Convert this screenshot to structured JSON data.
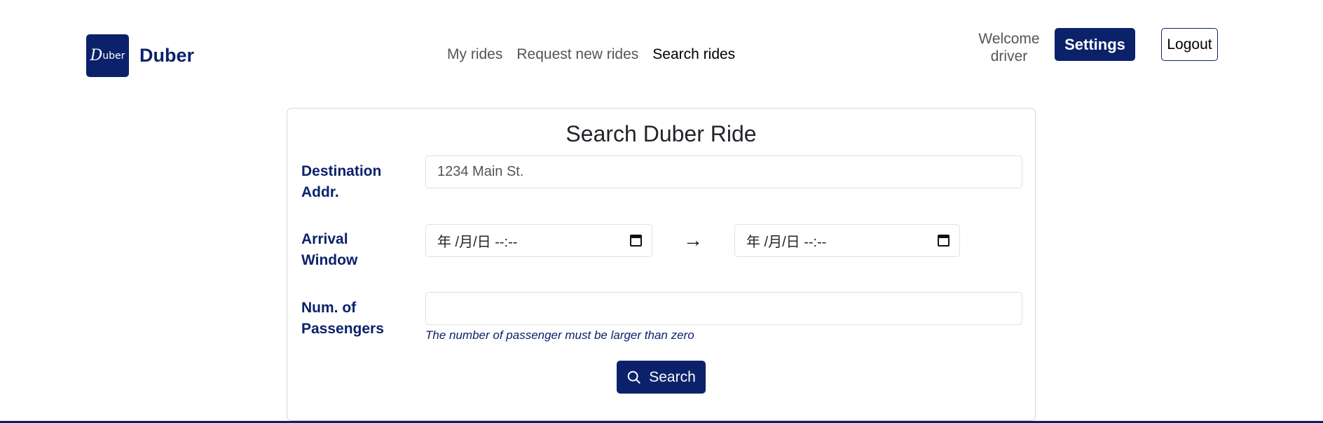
{
  "brand": {
    "logo_text_big": "D",
    "logo_text_small": "uber",
    "name": "Duber"
  },
  "nav": {
    "items": [
      {
        "label": "My rides",
        "active": false
      },
      {
        "label": "Request new rides",
        "active": false
      },
      {
        "label": "Search rides",
        "active": true
      }
    ]
  },
  "user": {
    "welcome_line1": "Welcome",
    "welcome_line2": "driver"
  },
  "header": {
    "settings_label": "Settings",
    "logout_label": "Logout"
  },
  "form": {
    "title": "Search Duber Ride",
    "destination": {
      "label_line1": "Destination",
      "label_line2": "Addr.",
      "value": "1234 Main St."
    },
    "arrival": {
      "label_line1": "Arrival",
      "label_line2": "Window",
      "start_placeholder": "年 /月/日 --:--",
      "end_placeholder": "年 /月/日 --:--",
      "arrow": "→"
    },
    "passengers": {
      "label_line1": "Num. of",
      "label_line2": "Passengers",
      "value": "",
      "hint": "The number of passenger must be larger than zero"
    },
    "search_label": "Search"
  },
  "colors": {
    "primary": "#0b226b",
    "border": "#dee2e6"
  }
}
